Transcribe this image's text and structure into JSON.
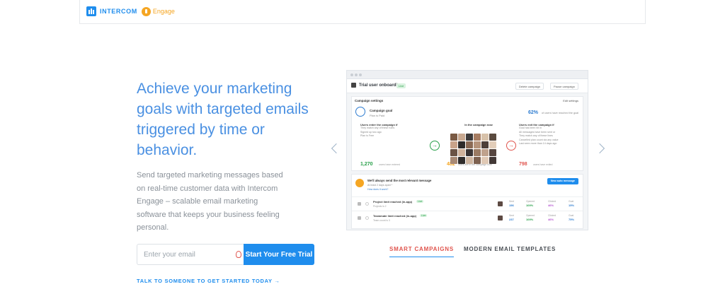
{
  "header": {
    "brand": "INTERCOM",
    "product": "Engage"
  },
  "hero": {
    "headline": "Achieve your marketing goals with targeted emails triggered by time or behavior.",
    "subcopy": "Send targeted marketing messages based on real-time customer data with Intercom Engage – scalable email marketing software that keeps your business feeling personal.",
    "email_placeholder": "Enter your email",
    "cta_label": "Start Your Free Trial",
    "talk_link": "TALK TO SOMEONE TO GET STARTED TODAY →"
  },
  "screenshot": {
    "title": "Trial user onboarding",
    "status": "Live",
    "actions": [
      "Delete campaign",
      "Pause campaign"
    ],
    "settings_label": "Campaign settings",
    "edit_label": "Edit settings",
    "goal": {
      "title": "Campaign goal",
      "sub": "Plan is Paid",
      "percent": "62%",
      "desc": "of users have reached the goal"
    },
    "enter": {
      "title": "Users enter the campaign if",
      "lines": [
        "They match any of these rules",
        "Signed up two ago",
        "Plan is Free"
      ],
      "count": "1,270",
      "note": "users have entered"
    },
    "in": {
      "title": "In the campaign now",
      "count": "482",
      "note": "users are in the campaign now"
    },
    "exit": {
      "title": "Users exit the campaign if",
      "lines": [
        "Goal has been hit in",
        "All messages have been sent or",
        "They match any of these lines",
        "Cancelled plan count via any value",
        "Last seen more than 14 days ago"
      ],
      "count": "798",
      "note": "users have exited"
    },
    "message": {
      "head": "We'll always send the most relevant message",
      "sub": "At least 2 days apart *",
      "link": "How does it work?",
      "new_label": "New auto message"
    },
    "rows": [
      {
        "name": "Project limit reached (in-app)",
        "status": "Live",
        "sub": "Projects is 2",
        "metrics": [
          {
            "label": "Sent",
            "value": "156"
          },
          {
            "label": "Opened",
            "value": "100%"
          },
          {
            "label": "Clicked",
            "value": "46%"
          },
          {
            "label": "Goal",
            "value": "15%"
          }
        ]
      },
      {
        "name": "Teammate limit reached (in-app)",
        "status": "Live",
        "sub": "Team count is 3",
        "metrics": [
          {
            "label": "Sent",
            "value": "237"
          },
          {
            "label": "Opened",
            "value": "100%"
          },
          {
            "label": "Clicked",
            "value": "46%"
          },
          {
            "label": "Goal",
            "value": "75%"
          }
        ]
      }
    ],
    "face_colors": [
      "#7a5a44",
      "#c8a890",
      "#3d3a3a",
      "#a77d62",
      "#d8c2aa",
      "#5a4a3f",
      "#c9a38a",
      "#2e2b2b",
      "#8b6a55",
      "#b5937b",
      "#4d403a",
      "#e2cdb9",
      "#6b5345",
      "#d1b39c",
      "#3a3434",
      "#9a7a63",
      "#bfa28d",
      "#564640",
      "#a98a75",
      "#312d2c",
      "#cfb6a1",
      "#7d6150",
      "#e0c9b5",
      "#423836"
    ]
  },
  "tabs": {
    "active": "SMART CAMPAIGNS",
    "inactive": "MODERN EMAIL TEMPLATES"
  },
  "colors": {
    "accent": "#1f8ded",
    "engage": "#f5a623",
    "headline": "#4a90e2",
    "tab_active": "#e0554e"
  }
}
